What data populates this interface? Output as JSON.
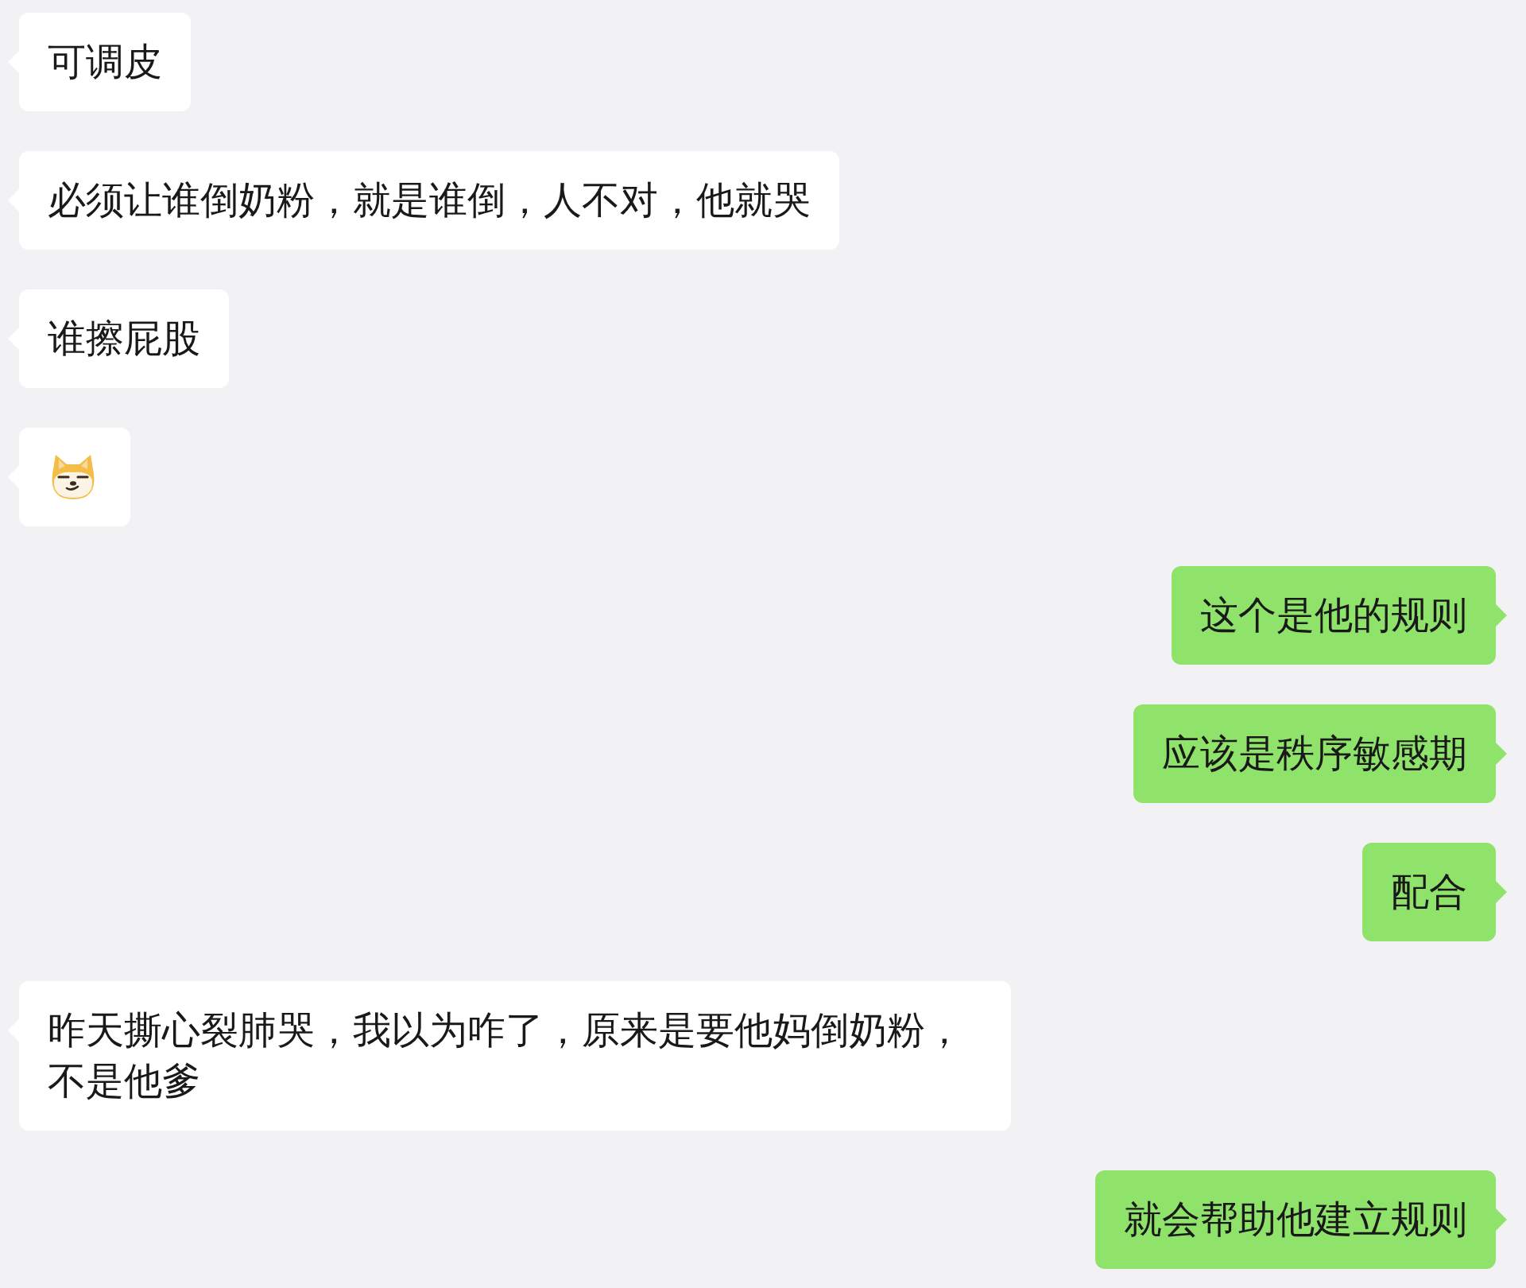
{
  "messages": [
    {
      "outgoing": false,
      "kind": "text",
      "text": "可调皮"
    },
    {
      "outgoing": false,
      "kind": "text",
      "text": "必须让谁倒奶粉，就是谁倒，人不对，他就哭"
    },
    {
      "outgoing": false,
      "kind": "text",
      "text": "谁擦屁股"
    },
    {
      "outgoing": false,
      "kind": "emoji"
    },
    {
      "outgoing": true,
      "kind": "text",
      "text": "这个是他的规则"
    },
    {
      "outgoing": true,
      "kind": "text",
      "text": "应该是秩序敏感期"
    },
    {
      "outgoing": true,
      "kind": "text",
      "text": "配合"
    },
    {
      "outgoing": false,
      "kind": "text",
      "text": "昨天撕心裂肺哭，我以为咋了，原来是要他妈倒奶粉，不是他爹"
    },
    {
      "outgoing": true,
      "kind": "text",
      "text": "就会帮助他建立规则"
    }
  ]
}
